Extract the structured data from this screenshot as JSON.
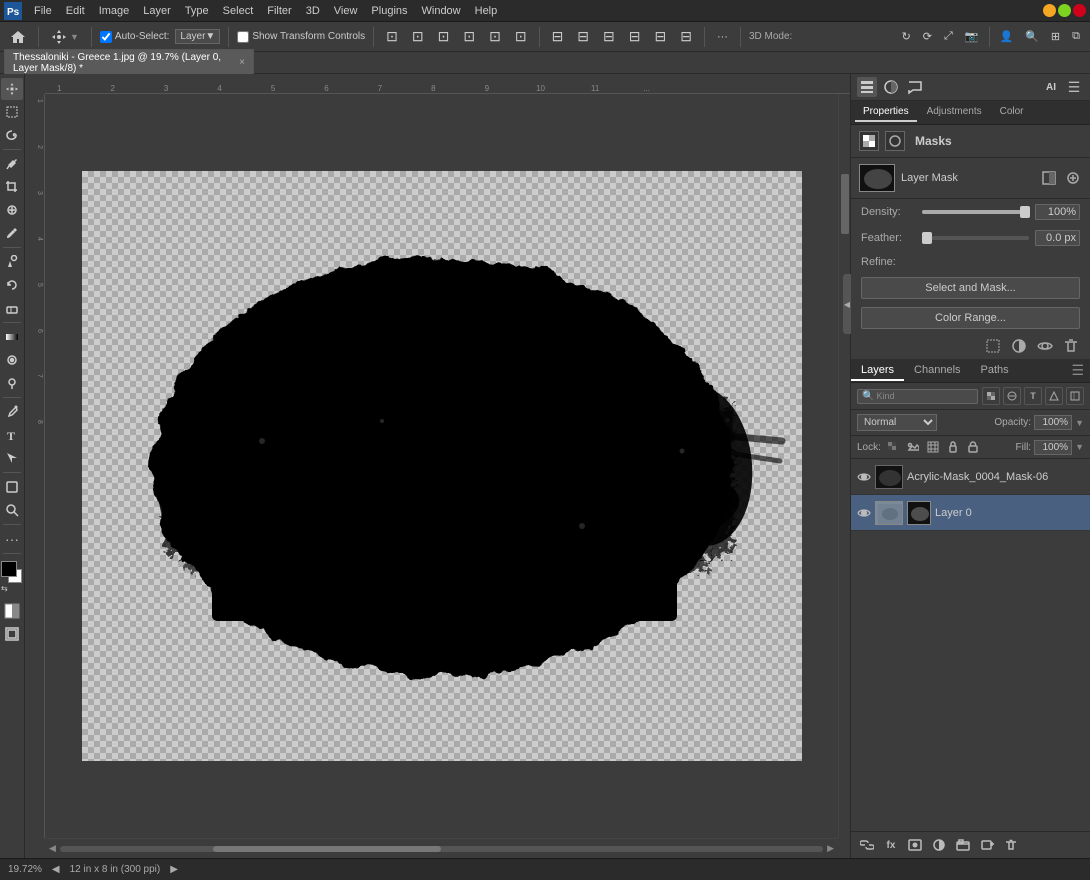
{
  "window": {
    "title": "Adobe Photoshop"
  },
  "menubar": {
    "items": [
      "PS",
      "File",
      "Edit",
      "Image",
      "Layer",
      "Type",
      "Select",
      "Filter",
      "3D",
      "View",
      "Plugins",
      "Window",
      "Help"
    ]
  },
  "toolbar": {
    "auto_select_label": "Auto-Select:",
    "auto_select_value": "Layer",
    "show_transform_label": "Show Transform Controls",
    "three_d_mode": "3D Mode:",
    "more_btn": "···"
  },
  "tabbar": {
    "doc_name": "Thessaloniki - Greece 1.jpg @ 19.7% (Layer 0, Layer Mask/8) *",
    "close_icon": "×"
  },
  "properties": {
    "tab_properties": "Properties",
    "tab_adjustments": "Adjustments",
    "tab_color": "Color",
    "masks_title": "Masks",
    "layer_mask_label": "Layer Mask",
    "density_label": "Density:",
    "density_value": "100%",
    "feather_label": "Feather:",
    "feather_value": "0.0 px",
    "refine_label": "Refine:",
    "select_mask_btn": "Select and Mask...",
    "color_range_btn": "Color Range..."
  },
  "layers": {
    "tab_layers": "Layers",
    "tab_channels": "Channels",
    "tab_paths": "Paths",
    "kind_label": "Kind",
    "blend_mode": "Normal",
    "opacity_label": "Opacity:",
    "opacity_value": "100%",
    "lock_label": "Lock:",
    "fill_label": "Fill:",
    "fill_value": "100%",
    "layer_items": [
      {
        "name": "Acrylic-Mask_0004_Mask-06",
        "visible": true,
        "selected": false,
        "has_mask": false
      },
      {
        "name": "Layer 0",
        "visible": true,
        "selected": true,
        "has_mask": true
      }
    ],
    "footer_icons": [
      "link",
      "fx",
      "mask",
      "adjustment",
      "group",
      "new",
      "delete"
    ]
  },
  "statusbar": {
    "zoom": "19.72%",
    "doc_size": "12 in x 8 in (300 ppi)"
  },
  "icons": {
    "eye": "👁",
    "close": "×",
    "search": "🔍",
    "lock": "🔒",
    "arrow_right": "▶",
    "arrow_left": "◀",
    "arrow_down": "▼",
    "settings": "⚙",
    "add": "+",
    "delete": "🗑",
    "link": "🔗",
    "move": "⊕",
    "fx": "fx"
  },
  "colors": {
    "bg": "#3c3c3c",
    "panel_bg": "#2f2f2f",
    "toolbar_bg": "#3c3c3c",
    "menubar_bg": "#2b2b2b",
    "active_tab": "#4a6080",
    "accent": "#fff"
  }
}
